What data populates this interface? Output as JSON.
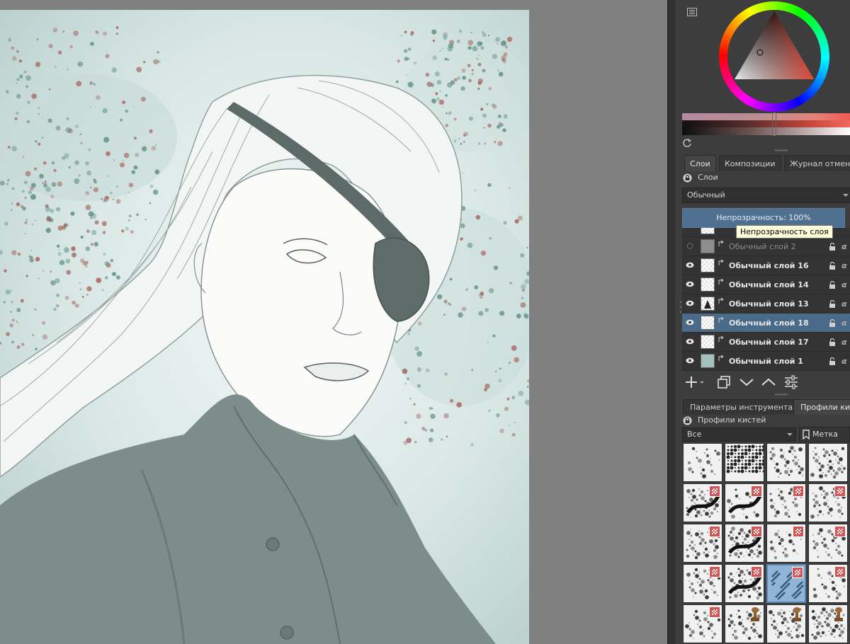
{
  "docker": {
    "tabs": [
      {
        "label": "Слои",
        "active": true
      },
      {
        "label": "Композиции",
        "active": false
      },
      {
        "label": "Журнал отмены",
        "active": false
      }
    ],
    "layers_title": "Слои",
    "blend_mode": "Обычный",
    "opacity_label": "Непрозрачность:  100%",
    "opacity_tooltip": "Непрозрачность слоя",
    "layers": [
      {
        "name": "Обычный слой 2",
        "visible": false,
        "selected": false
      },
      {
        "name": "Обычный слой 16",
        "visible": true,
        "selected": false
      },
      {
        "name": "Обычный слой 14",
        "visible": true,
        "selected": false
      },
      {
        "name": "Обычный слой 13",
        "visible": true,
        "selected": false
      },
      {
        "name": "Обычный слой 18",
        "visible": true,
        "selected": true
      },
      {
        "name": "Обычный слой 17",
        "visible": true,
        "selected": false
      },
      {
        "name": "Обычный слой 1",
        "visible": true,
        "selected": false
      }
    ],
    "alpha_glyph": "α",
    "toolbar_icons": [
      "add-layer-icon",
      "duplicate-layer-icon",
      "move-down-icon",
      "move-up-icon",
      "layer-properties-icon"
    ],
    "lower_tabs": [
      {
        "label": "Параметры инструмента",
        "active": false
      },
      {
        "label": "Профили кистей",
        "active": true
      }
    ],
    "brushes_title": "Профили кистей",
    "brush_filter": "Все",
    "tag_label": "Метка",
    "selected_brush_index": 14
  },
  "colors": {
    "accent": "#4f7090",
    "selected_row": "#4a6a8a",
    "panel": "#3d3d3d",
    "canvas_bg": "#808080",
    "current_color": "#c5453a"
  }
}
